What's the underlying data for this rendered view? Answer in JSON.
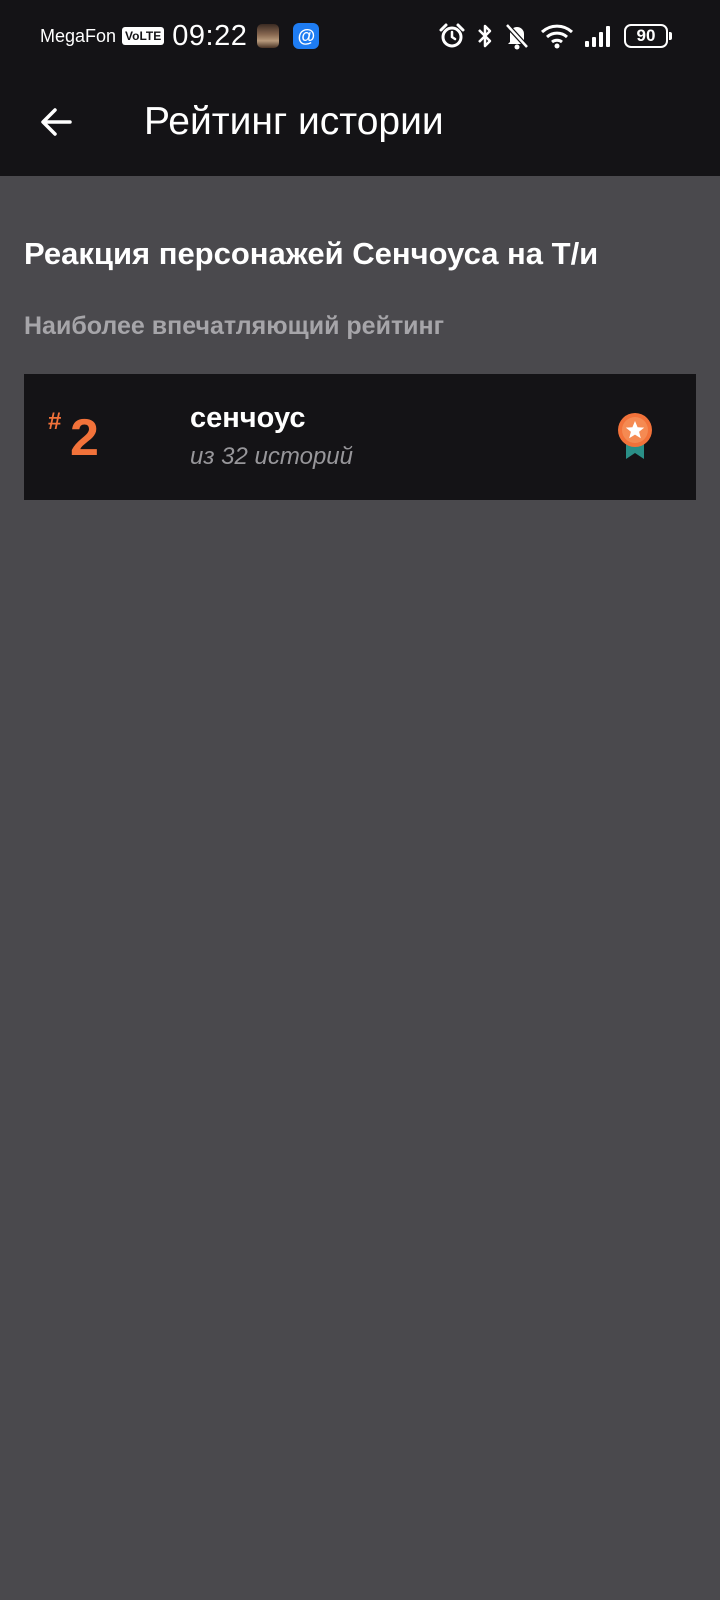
{
  "status_bar": {
    "carrier": "MegaFon",
    "volte": "VoLTE",
    "time": "09:22",
    "mail_icon_glyph": "@",
    "battery": "90",
    "icons": [
      "alarm-icon",
      "bluetooth-icon",
      "bell-muted-icon",
      "wifi-icon",
      "signal-icon",
      "battery-icon"
    ]
  },
  "app_bar": {
    "title": "Рейтинг истории",
    "back_icon": "arrow-left-icon"
  },
  "story": {
    "title": "Реакция персонажей Сенчоуса на Т/и",
    "section_label": "Наиболее впечатляющий рейтинг"
  },
  "ranking": {
    "hash": "#",
    "rank": "2",
    "tag": "сенчоус",
    "subtitle": "из 32 историй",
    "badge_icon": "medal-star-icon"
  },
  "colors": {
    "accent": "#f2723a",
    "bar_background": "#141316",
    "page_background": "#4a494d",
    "muted_text": "#a6a5a9",
    "medal_ribbon": "#2a8f87"
  }
}
